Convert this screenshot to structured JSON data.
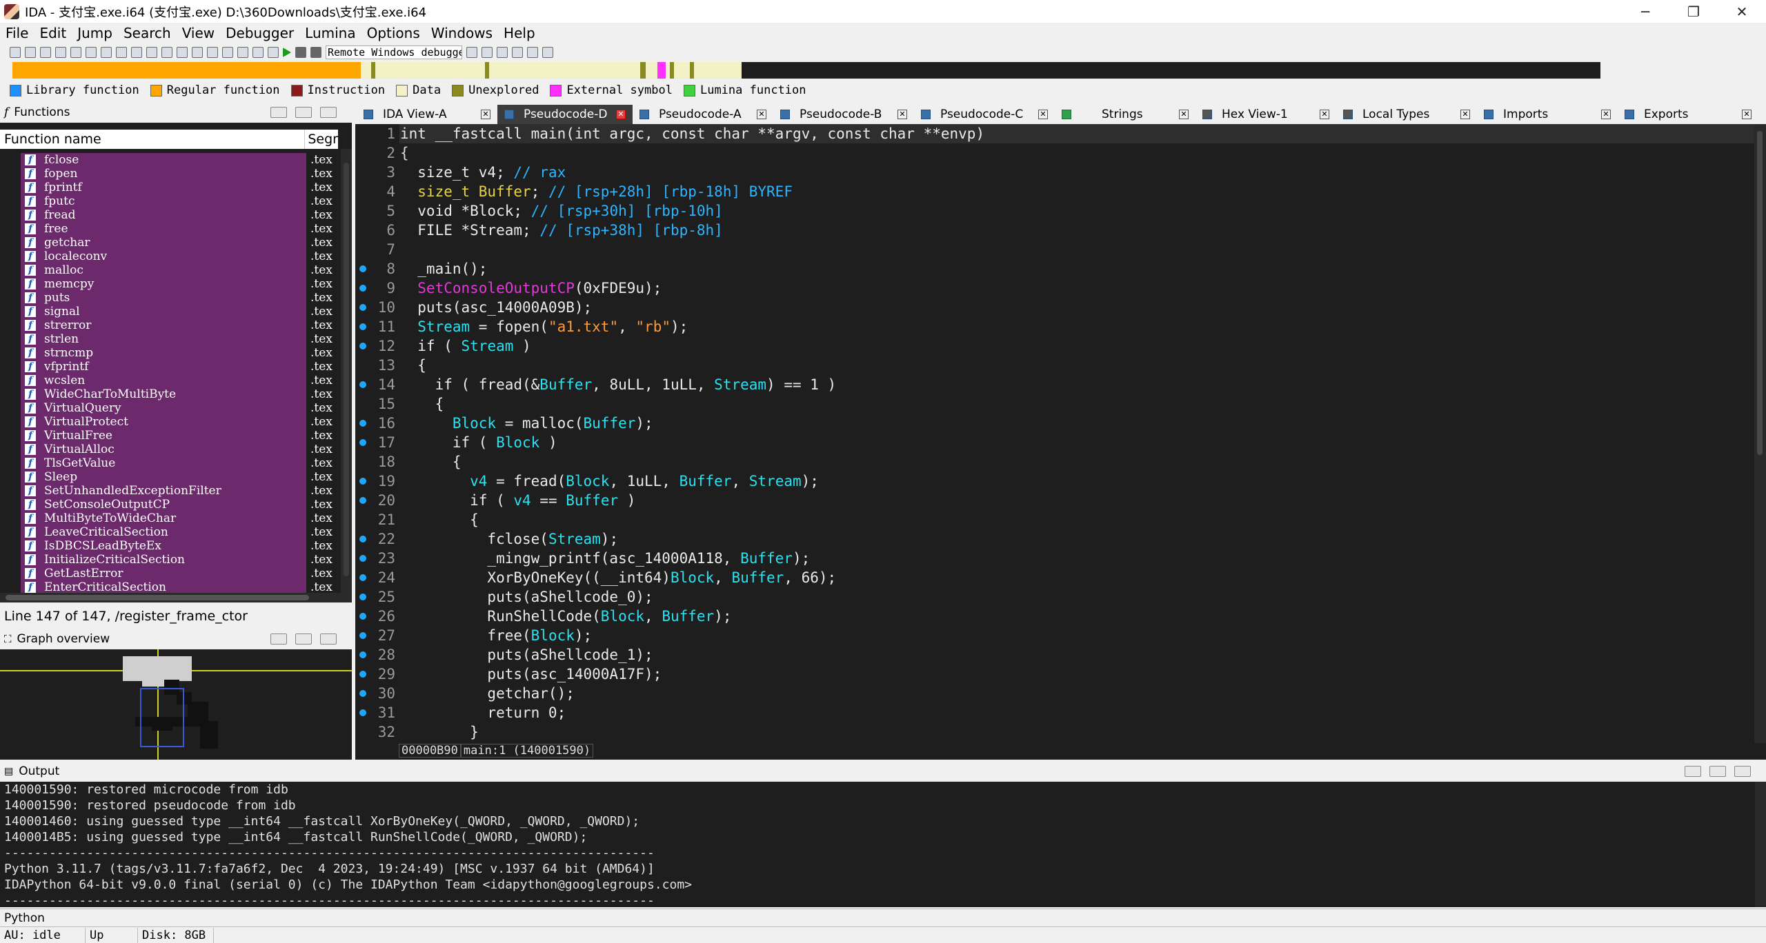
{
  "window": {
    "title": "IDA - 支付宝.exe.i64 (支付宝.exe) D:\\360Downloads\\支付宝.exe.i64",
    "minimize": "─",
    "maximize": "❐",
    "close": "✕"
  },
  "menu": [
    "File",
    "Edit",
    "Jump",
    "Search",
    "View",
    "Debugger",
    "Lumina",
    "Options",
    "Windows",
    "Help"
  ],
  "toolbar": {
    "debugger_select": "Remote Windows debugger"
  },
  "legend": [
    {
      "label": "Library function",
      "color": "#1e90ff"
    },
    {
      "label": "Regular function",
      "color": "#ffa500"
    },
    {
      "label": "Instruction",
      "color": "#8b1a1a"
    },
    {
      "label": "Data",
      "color": "#f2f2c6"
    },
    {
      "label": "Unexplored",
      "color": "#8a8a20"
    },
    {
      "label": "External symbol",
      "color": "#ff30ff"
    },
    {
      "label": "Lumina function",
      "color": "#40d040"
    }
  ],
  "functions": {
    "title": "Functions",
    "col_name": "Function name",
    "col_seg": "Segr",
    "items": [
      "fclose",
      "fopen",
      "fprintf",
      "fputc",
      "fread",
      "free",
      "getchar",
      "localeconv",
      "malloc",
      "memcpy",
      "puts",
      "signal",
      "strerror",
      "strlen",
      "strncmp",
      "vfprintf",
      "wcslen",
      "WideCharToMultiByte",
      "VirtualQuery",
      "VirtualProtect",
      "VirtualFree",
      "VirtualAlloc",
      "TlsGetValue",
      "Sleep",
      "SetUnhandledExceptionFilter",
      "SetConsoleOutputCP",
      "MultiByteToWideChar",
      "LeaveCriticalSection",
      "IsDBCSLeadByteEx",
      "InitializeCriticalSection",
      "GetLastError",
      "EnterCriticalSection"
    ],
    "segment": ".tex",
    "status": "Line 147 of 147, /register_frame_ctor"
  },
  "graph": {
    "title": "Graph overview"
  },
  "tabs": [
    {
      "label": "IDA View-A",
      "active": false
    },
    {
      "label": "Pseudocode-D",
      "active": true
    },
    {
      "label": "Pseudocode-A",
      "active": false
    },
    {
      "label": "Pseudocode-B",
      "active": false
    },
    {
      "label": "Pseudocode-C",
      "active": false
    },
    {
      "label": "Strings",
      "active": false
    },
    {
      "label": "Hex View-1",
      "active": false
    },
    {
      "label": "Local Types",
      "active": false
    },
    {
      "label": "Imports",
      "active": false
    },
    {
      "label": "Exports",
      "active": false
    }
  ],
  "code": {
    "lines": [
      {
        "n": "1",
        "dot": false,
        "t": [
          [
            "ty",
            "int __fastcall main(int argc, const char **argv, const char **envp)"
          ]
        ]
      },
      {
        "n": "2",
        "dot": false,
        "t": [
          [
            "kw",
            "{"
          ]
        ]
      },
      {
        "n": "3",
        "dot": false,
        "t": [
          [
            "ty",
            "  size_t v4; "
          ],
          [
            "cm",
            "// rax"
          ]
        ]
      },
      {
        "n": "4",
        "dot": false,
        "t": [
          [
            "tyy",
            "  size_t Buffer"
          ],
          [
            "ty",
            "; "
          ],
          [
            "cm",
            "// [rsp+28h] [rbp-18h] BYREF"
          ]
        ]
      },
      {
        "n": "5",
        "dot": false,
        "t": [
          [
            "ty",
            "  void *Block; "
          ],
          [
            "cm",
            "// [rsp+30h] [rbp-10h]"
          ]
        ]
      },
      {
        "n": "6",
        "dot": false,
        "t": [
          [
            "ty",
            "  FILE *Stream; "
          ],
          [
            "cm",
            "// [rsp+38h] [rbp-8h]"
          ]
        ]
      },
      {
        "n": "7",
        "dot": false,
        "t": [
          [
            "ty",
            ""
          ]
        ]
      },
      {
        "n": "8",
        "dot": true,
        "t": [
          [
            "ty",
            "  _main();"
          ]
        ]
      },
      {
        "n": "9",
        "dot": true,
        "t": [
          [
            "fn",
            "  SetConsoleOutputCP"
          ],
          [
            "ty",
            "(0xFDE9u);"
          ]
        ]
      },
      {
        "n": "10",
        "dot": true,
        "t": [
          [
            "ty",
            "  puts(asc_14000A09B);"
          ]
        ]
      },
      {
        "n": "11",
        "dot": true,
        "t": [
          [
            "var",
            "  Stream"
          ],
          [
            "ty",
            " = fopen("
          ],
          [
            "str",
            "\"a1.txt\""
          ],
          [
            "ty",
            ", "
          ],
          [
            "str",
            "\"rb\""
          ],
          [
            "ty",
            ");"
          ]
        ]
      },
      {
        "n": "12",
        "dot": true,
        "t": [
          [
            "ty",
            "  if ( "
          ],
          [
            "var",
            "Stream"
          ],
          [
            "ty",
            " )"
          ]
        ]
      },
      {
        "n": "13",
        "dot": false,
        "t": [
          [
            "ty",
            "  {"
          ]
        ]
      },
      {
        "n": "14",
        "dot": true,
        "t": [
          [
            "ty",
            "    if ( fread(&"
          ],
          [
            "var",
            "Buffer"
          ],
          [
            "ty",
            ", 8uLL, 1uLL, "
          ],
          [
            "var",
            "Stream"
          ],
          [
            "ty",
            ") == 1 )"
          ]
        ]
      },
      {
        "n": "15",
        "dot": false,
        "t": [
          [
            "ty",
            "    {"
          ]
        ]
      },
      {
        "n": "16",
        "dot": true,
        "t": [
          [
            "var",
            "      Block"
          ],
          [
            "ty",
            " = malloc("
          ],
          [
            "var",
            "Buffer"
          ],
          [
            "ty",
            ");"
          ]
        ]
      },
      {
        "n": "17",
        "dot": true,
        "t": [
          [
            "ty",
            "      if ( "
          ],
          [
            "var",
            "Block"
          ],
          [
            "ty",
            " )"
          ]
        ]
      },
      {
        "n": "18",
        "dot": false,
        "t": [
          [
            "ty",
            "      {"
          ]
        ]
      },
      {
        "n": "19",
        "dot": true,
        "t": [
          [
            "var",
            "        v4"
          ],
          [
            "ty",
            " = fread("
          ],
          [
            "var",
            "Block"
          ],
          [
            "ty",
            ", 1uLL, "
          ],
          [
            "var",
            "Buffer"
          ],
          [
            "ty",
            ", "
          ],
          [
            "var",
            "Stream"
          ],
          [
            "ty",
            ");"
          ]
        ]
      },
      {
        "n": "20",
        "dot": true,
        "t": [
          [
            "ty",
            "        if ( "
          ],
          [
            "var",
            "v4"
          ],
          [
            "ty",
            " == "
          ],
          [
            "var",
            "Buffer"
          ],
          [
            "ty",
            " )"
          ]
        ]
      },
      {
        "n": "21",
        "dot": false,
        "t": [
          [
            "ty",
            "        {"
          ]
        ]
      },
      {
        "n": "22",
        "dot": true,
        "t": [
          [
            "ty",
            "          fclose("
          ],
          [
            "var",
            "Stream"
          ],
          [
            "ty",
            ");"
          ]
        ]
      },
      {
        "n": "23",
        "dot": true,
        "t": [
          [
            "ty",
            "          _mingw_printf(asc_14000A118, "
          ],
          [
            "var",
            "Buffer"
          ],
          [
            "ty",
            ");"
          ]
        ]
      },
      {
        "n": "24",
        "dot": true,
        "t": [
          [
            "ty",
            "          XorByOneKey((__int64)"
          ],
          [
            "var",
            "Block"
          ],
          [
            "ty",
            ", "
          ],
          [
            "var",
            "Buffer"
          ],
          [
            "ty",
            ", 66);"
          ]
        ]
      },
      {
        "n": "25",
        "dot": true,
        "t": [
          [
            "ty",
            "          puts(aShellcode_0);"
          ]
        ]
      },
      {
        "n": "26",
        "dot": true,
        "t": [
          [
            "ty",
            "          RunShellCode("
          ],
          [
            "var",
            "Block"
          ],
          [
            "ty",
            ", "
          ],
          [
            "var",
            "Buffer"
          ],
          [
            "ty",
            ");"
          ]
        ]
      },
      {
        "n": "27",
        "dot": true,
        "t": [
          [
            "ty",
            "          free("
          ],
          [
            "var",
            "Block"
          ],
          [
            "ty",
            ");"
          ]
        ]
      },
      {
        "n": "28",
        "dot": true,
        "t": [
          [
            "ty",
            "          puts(aShellcode_1);"
          ]
        ]
      },
      {
        "n": "29",
        "dot": true,
        "t": [
          [
            "ty",
            "          puts(asc_14000A17F);"
          ]
        ]
      },
      {
        "n": "30",
        "dot": true,
        "t": [
          [
            "ty",
            "          getchar();"
          ]
        ]
      },
      {
        "n": "31",
        "dot": true,
        "t": [
          [
            "ty",
            "          return 0;"
          ]
        ]
      },
      {
        "n": "32",
        "dot": false,
        "t": [
          [
            "ty",
            "        }"
          ]
        ]
      }
    ],
    "status_addr": "00000B90",
    "status_loc": "main:1 (140001590)"
  },
  "output": {
    "title": "Output",
    "lines": [
      "140001590: restored microcode from idb",
      "140001590: restored pseudocode from idb",
      "140001460: using guessed type __int64 __fastcall XorByOneKey(_QWORD, _QWORD, _QWORD);",
      "1400014B5: using guessed type __int64 __fastcall RunShellCode(_QWORD, _QWORD);",
      "---------------------------------------------------------------------------------------",
      "Python 3.11.7 (tags/v3.11.7:fa7a6f2, Dec  4 2023, 19:24:49) [MSC v.1937 64 bit (AMD64)]",
      "IDAPython 64-bit v9.0.0 final (serial 0) (c) The IDAPython Team <idapython@googlegroups.com>",
      "---------------------------------------------------------------------------------------"
    ]
  },
  "python_label": "Python",
  "statusbar": {
    "au": "AU:  idle",
    "dir": "Up",
    "disk": "Disk: 8GB"
  }
}
